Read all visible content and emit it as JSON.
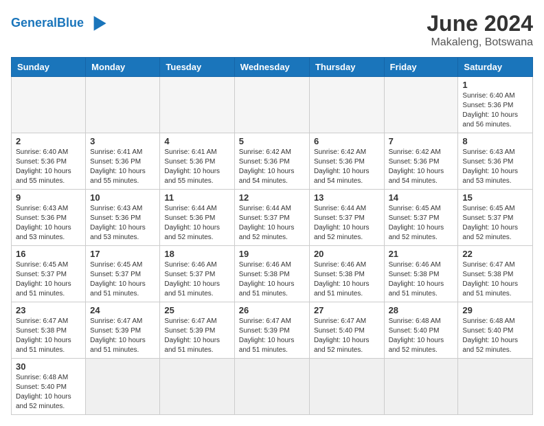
{
  "header": {
    "logo_line1": "General",
    "logo_line2": "Blue",
    "month_year": "June 2024",
    "location": "Makaleng, Botswana"
  },
  "weekdays": [
    "Sunday",
    "Monday",
    "Tuesday",
    "Wednesday",
    "Thursday",
    "Friday",
    "Saturday"
  ],
  "weeks": [
    [
      {
        "day": "",
        "info": ""
      },
      {
        "day": "",
        "info": ""
      },
      {
        "day": "",
        "info": ""
      },
      {
        "day": "",
        "info": ""
      },
      {
        "day": "",
        "info": ""
      },
      {
        "day": "",
        "info": ""
      },
      {
        "day": "1",
        "info": "Sunrise: 6:40 AM\nSunset: 5:36 PM\nDaylight: 10 hours\nand 56 minutes."
      }
    ],
    [
      {
        "day": "2",
        "info": "Sunrise: 6:40 AM\nSunset: 5:36 PM\nDaylight: 10 hours\nand 55 minutes."
      },
      {
        "day": "3",
        "info": "Sunrise: 6:41 AM\nSunset: 5:36 PM\nDaylight: 10 hours\nand 55 minutes."
      },
      {
        "day": "4",
        "info": "Sunrise: 6:41 AM\nSunset: 5:36 PM\nDaylight: 10 hours\nand 55 minutes."
      },
      {
        "day": "5",
        "info": "Sunrise: 6:42 AM\nSunset: 5:36 PM\nDaylight: 10 hours\nand 54 minutes."
      },
      {
        "day": "6",
        "info": "Sunrise: 6:42 AM\nSunset: 5:36 PM\nDaylight: 10 hours\nand 54 minutes."
      },
      {
        "day": "7",
        "info": "Sunrise: 6:42 AM\nSunset: 5:36 PM\nDaylight: 10 hours\nand 54 minutes."
      },
      {
        "day": "8",
        "info": "Sunrise: 6:43 AM\nSunset: 5:36 PM\nDaylight: 10 hours\nand 53 minutes."
      }
    ],
    [
      {
        "day": "9",
        "info": "Sunrise: 6:43 AM\nSunset: 5:36 PM\nDaylight: 10 hours\nand 53 minutes."
      },
      {
        "day": "10",
        "info": "Sunrise: 6:43 AM\nSunset: 5:36 PM\nDaylight: 10 hours\nand 53 minutes."
      },
      {
        "day": "11",
        "info": "Sunrise: 6:44 AM\nSunset: 5:36 PM\nDaylight: 10 hours\nand 52 minutes."
      },
      {
        "day": "12",
        "info": "Sunrise: 6:44 AM\nSunset: 5:37 PM\nDaylight: 10 hours\nand 52 minutes."
      },
      {
        "day": "13",
        "info": "Sunrise: 6:44 AM\nSunset: 5:37 PM\nDaylight: 10 hours\nand 52 minutes."
      },
      {
        "day": "14",
        "info": "Sunrise: 6:45 AM\nSunset: 5:37 PM\nDaylight: 10 hours\nand 52 minutes."
      },
      {
        "day": "15",
        "info": "Sunrise: 6:45 AM\nSunset: 5:37 PM\nDaylight: 10 hours\nand 52 minutes."
      }
    ],
    [
      {
        "day": "16",
        "info": "Sunrise: 6:45 AM\nSunset: 5:37 PM\nDaylight: 10 hours\nand 51 minutes."
      },
      {
        "day": "17",
        "info": "Sunrise: 6:45 AM\nSunset: 5:37 PM\nDaylight: 10 hours\nand 51 minutes."
      },
      {
        "day": "18",
        "info": "Sunrise: 6:46 AM\nSunset: 5:37 PM\nDaylight: 10 hours\nand 51 minutes."
      },
      {
        "day": "19",
        "info": "Sunrise: 6:46 AM\nSunset: 5:38 PM\nDaylight: 10 hours\nand 51 minutes."
      },
      {
        "day": "20",
        "info": "Sunrise: 6:46 AM\nSunset: 5:38 PM\nDaylight: 10 hours\nand 51 minutes."
      },
      {
        "day": "21",
        "info": "Sunrise: 6:46 AM\nSunset: 5:38 PM\nDaylight: 10 hours\nand 51 minutes."
      },
      {
        "day": "22",
        "info": "Sunrise: 6:47 AM\nSunset: 5:38 PM\nDaylight: 10 hours\nand 51 minutes."
      }
    ],
    [
      {
        "day": "23",
        "info": "Sunrise: 6:47 AM\nSunset: 5:38 PM\nDaylight: 10 hours\nand 51 minutes."
      },
      {
        "day": "24",
        "info": "Sunrise: 6:47 AM\nSunset: 5:39 PM\nDaylight: 10 hours\nand 51 minutes."
      },
      {
        "day": "25",
        "info": "Sunrise: 6:47 AM\nSunset: 5:39 PM\nDaylight: 10 hours\nand 51 minutes."
      },
      {
        "day": "26",
        "info": "Sunrise: 6:47 AM\nSunset: 5:39 PM\nDaylight: 10 hours\nand 51 minutes."
      },
      {
        "day": "27",
        "info": "Sunrise: 6:47 AM\nSunset: 5:40 PM\nDaylight: 10 hours\nand 52 minutes."
      },
      {
        "day": "28",
        "info": "Sunrise: 6:48 AM\nSunset: 5:40 PM\nDaylight: 10 hours\nand 52 minutes."
      },
      {
        "day": "29",
        "info": "Sunrise: 6:48 AM\nSunset: 5:40 PM\nDaylight: 10 hours\nand 52 minutes."
      }
    ],
    [
      {
        "day": "30",
        "info": "Sunrise: 6:48 AM\nSunset: 5:40 PM\nDaylight: 10 hours\nand 52 minutes."
      },
      {
        "day": "",
        "info": ""
      },
      {
        "day": "",
        "info": ""
      },
      {
        "day": "",
        "info": ""
      },
      {
        "day": "",
        "info": ""
      },
      {
        "day": "",
        "info": ""
      },
      {
        "day": "",
        "info": ""
      }
    ]
  ]
}
